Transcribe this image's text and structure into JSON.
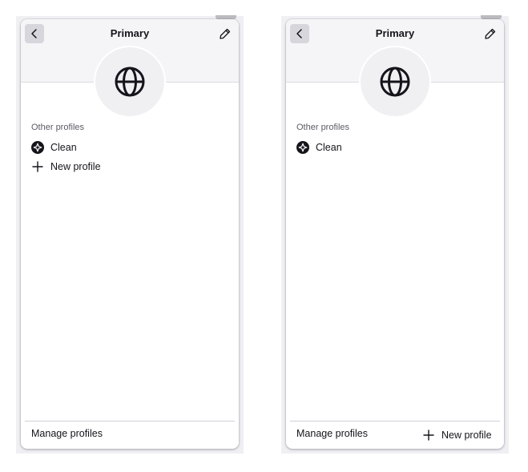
{
  "panels": [
    {
      "variant": "list-with-new-profile",
      "title": "Primary",
      "avatar_icon": "globe-icon",
      "other_profiles_label": "Other profiles",
      "profiles": [
        {
          "name": "Clean",
          "icon": "compass-icon"
        }
      ],
      "new_profile_label": "New profile",
      "manage_profiles_label": "Manage profiles"
    },
    {
      "variant": "footer-with-new-profile",
      "title": "Primary",
      "avatar_icon": "globe-icon",
      "other_profiles_label": "Other profiles",
      "profiles": [
        {
          "name": "Clean",
          "icon": "compass-icon"
        }
      ],
      "manage_profiles_label": "Manage profiles",
      "new_profile_label": "New profile"
    }
  ],
  "colors": {
    "panel_background": "#ffffff",
    "header_band": "#f5f5f8",
    "text": "#15141a",
    "muted_text": "#5b5b66",
    "back_button": "#d6d6dc"
  }
}
